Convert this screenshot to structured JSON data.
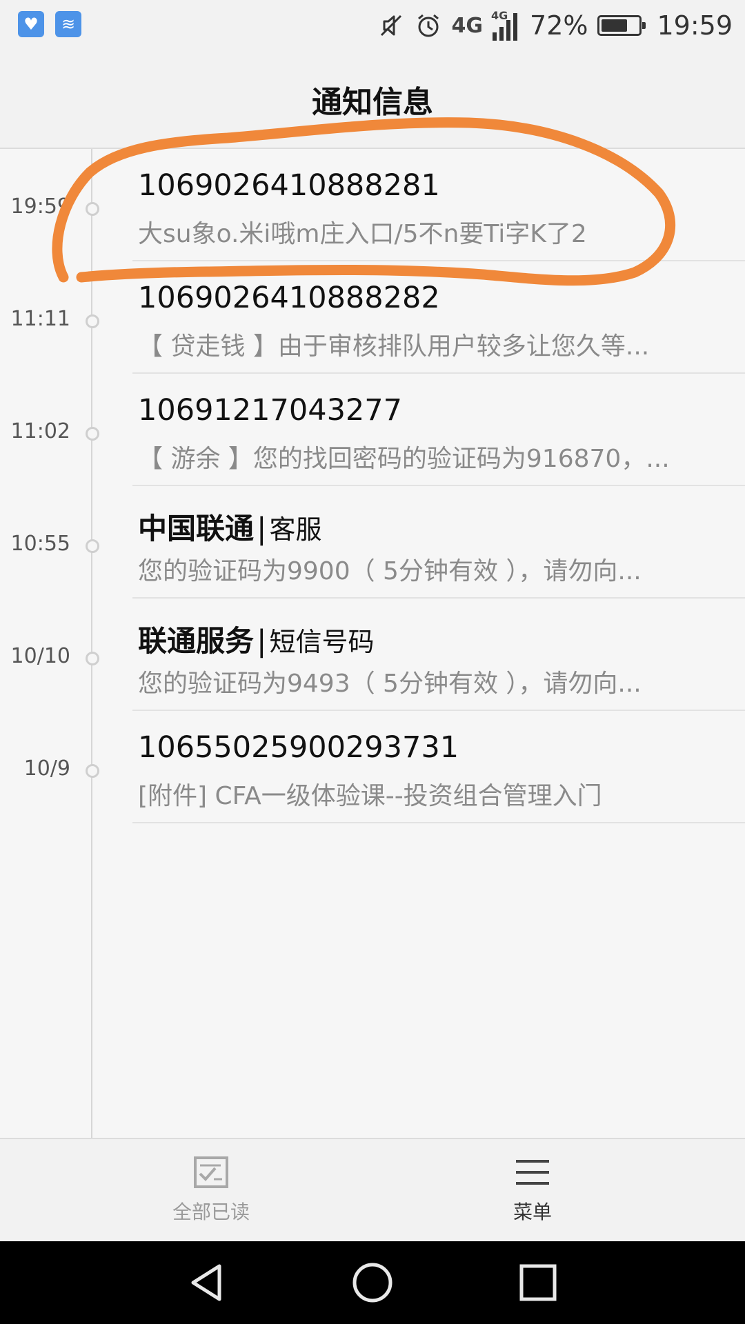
{
  "status_bar": {
    "left_icons": [
      {
        "icon": "health-app-icon",
        "glyph": "♥"
      },
      {
        "icon": "wifi-app-icon",
        "glyph": "≋"
      }
    ],
    "network_primary": "4G",
    "network_secondary": "4G",
    "battery_text": "72%",
    "battery_level": 0.72,
    "time": "19:59",
    "icons": [
      "mute-icon",
      "alarm-icon",
      "signal-icon",
      "battery-icon"
    ]
  },
  "header": {
    "title": "通知信息"
  },
  "messages": [
    {
      "time": "19:59",
      "sender": "1069026410888281",
      "sender_tag": "",
      "preview": "大su象o.米i哦m庄入口/5不n要Ti字K了2",
      "highlighted": true
    },
    {
      "time": "11:11",
      "sender": "1069026410888282",
      "sender_tag": "",
      "preview": "【 贷走钱 】由于审核排队用户较多让您久等..."
    },
    {
      "time": "11:02",
      "sender": "10691217043277",
      "sender_tag": "",
      "preview": "【 游余 】您的找回密码的验证码为916870，..."
    },
    {
      "time": "10:55",
      "sender": "中国联通",
      "sender_tag": "客服",
      "preview": "您的验证码为9900（ 5分钟有效 ），请勿向..."
    },
    {
      "time": "10/10",
      "sender": "联通服务",
      "sender_tag": "短信号码",
      "preview": "您的验证码为9493（ 5分钟有效 ），请勿向..."
    },
    {
      "time": "10/9",
      "sender": "10655025900293731",
      "sender_tag": "",
      "preview": "[附件] CFA一级体验课--投资组合管理入门"
    }
  ],
  "toolbar": {
    "mark_all_read_label": "全部已读",
    "menu_label": "菜单",
    "mark_all_read_icon": "checklist-icon",
    "menu_icon": "menu-icon"
  },
  "nav_bar": {
    "icons": [
      "back-icon",
      "home-icon",
      "recent-apps-icon"
    ]
  },
  "colors": {
    "background": "#f6f6f6",
    "bar_background": "#f2f2f2",
    "preview_text": "#8a8a8a",
    "highlight_stroke": "#f0883a",
    "nav_background": "#000000"
  }
}
